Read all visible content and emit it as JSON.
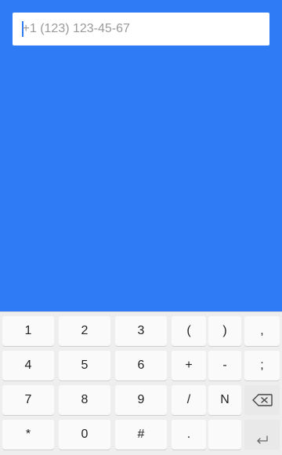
{
  "phone_field": {
    "placeholder": "+1 (123) 123-45-67",
    "value": ""
  },
  "keyboard": {
    "rows": [
      [
        "1",
        "2",
        "3",
        "(",
        ")",
        ","
      ],
      [
        "4",
        "5",
        "6",
        "+",
        "-",
        ";"
      ],
      [
        "7",
        "8",
        "9",
        "/",
        "N",
        ""
      ],
      [
        "*",
        "0",
        "#",
        ".",
        "",
        ""
      ]
    ],
    "backspace_icon": "backspace-icon",
    "enter_icon": "enter-icon"
  },
  "colors": {
    "background": "#2f7bf5",
    "keyboard": "#eeeeee",
    "key": "#fafafa"
  }
}
